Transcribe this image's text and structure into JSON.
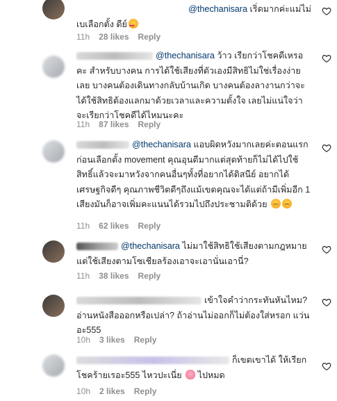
{
  "comments": [
    {
      "mention": "@thechanisara",
      "text_after_mention": " เริ่ดมากค่ะแม่ไม่",
      "line2": "เบเลือกตั้ง ดีย์",
      "time": "11h",
      "likes": "28 likes",
      "reply": "Reply"
    },
    {
      "mention": "@thechanisara",
      "text": " ว้าว เรียกว่าโชคดีเหรอคะ สำหรับบางคน การได้ใช้เสียงที่ตัวเองมีสิทธิไม่ใช่เรื่องง่ายเลย บางคนต้องเดินทางกลับบ้านเกิด บางคนต้องลางานกว่าจะได้ใช้สิทธิต้องแลกมาด้วยเวลาและความตั้งใจ เลยไม่แน่ใจว่าจะเรียกว่าโชคดีได้ไหมนะคะ",
      "time": "11h",
      "likes": "87 likes",
      "reply": "Reply"
    },
    {
      "mention": "@thechanisara",
      "text": " แอบผิดหวังมากเลยค่ะตอนแรกก่อนเลือกตั้ง movement คุณอุนดีมากแต่สุดท้ายก็ไม่ได้ไปใช้สิทธิ์แล้วจะมาหวังจากคนอื่นๆทั้งที่อยากได้ดิสนีย์ อยากได้เศรษฐกิจดีๆ คุณภาพชีวิตดีๆถึงแม้เขตคุณจะได้แต่ถ้ามีเพิ่มอีก 1 เสียงมันก็อาจเพิ่มคะแนนได้รวมไปถึงประชามติด้วย",
      "time": "11h",
      "likes": "62 likes",
      "reply": "Reply"
    },
    {
      "mention": "@thechanisara",
      "text": " ไม่มาใช้สิทธิใช้เสียงตามกฎหมาย แต่ใช้เสียงตามโซเชียลร้องเอาจะเอานั่นเอานี่?",
      "time": "11h",
      "likes": "38 likes",
      "reply": "Reply"
    },
    {
      "text": "เข้าใจคำว่ากระทันหันไหม? อ่านหนังสือออกหรือเปล่า? ถ้าอ่านไม่ออกก็ไม่ต้องใส่หรอก แว่นอะ555",
      "time": "10h",
      "likes": "3 likes",
      "reply": "Reply"
    },
    {
      "text": "ก็เขตเขาได้ ให้เรียก โชคร้ายเรอะ555 ไหวปะเนี่ย",
      "text_end": "ไปหมด",
      "time": "10h",
      "likes": "2 likes",
      "reply": "Reply"
    }
  ],
  "colors": {
    "mention": "#00376b",
    "meta": "#8e8e8e",
    "text": "#262626"
  },
  "icons": {
    "like": "heart-outline-icon"
  }
}
